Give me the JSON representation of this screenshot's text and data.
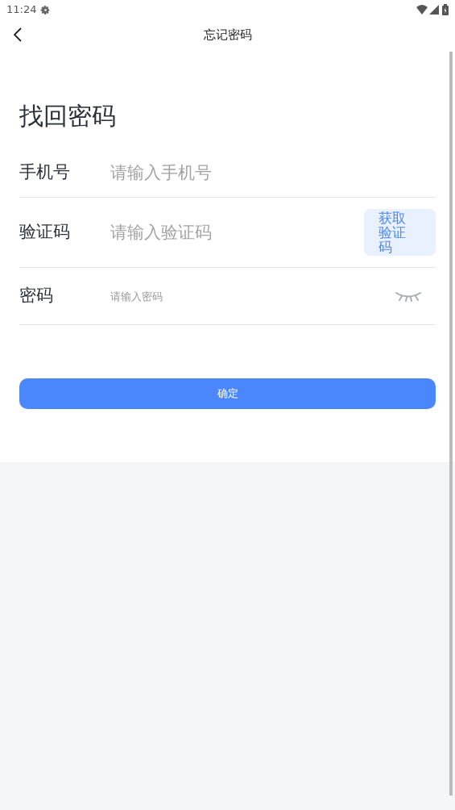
{
  "status_bar": {
    "time": "11:24"
  },
  "header": {
    "title": "忘记密码"
  },
  "heading": "找回密码",
  "fields": [
    {
      "kind": "phone",
      "label": "手机号",
      "placeholder": "请输入手机号"
    },
    {
      "kind": "code",
      "label": "验证码",
      "placeholder": "请输入验证码",
      "button": "获取验证码"
    },
    {
      "kind": "password",
      "label": "密码",
      "placeholder": "请输入密码"
    }
  ],
  "submit": "确定"
}
